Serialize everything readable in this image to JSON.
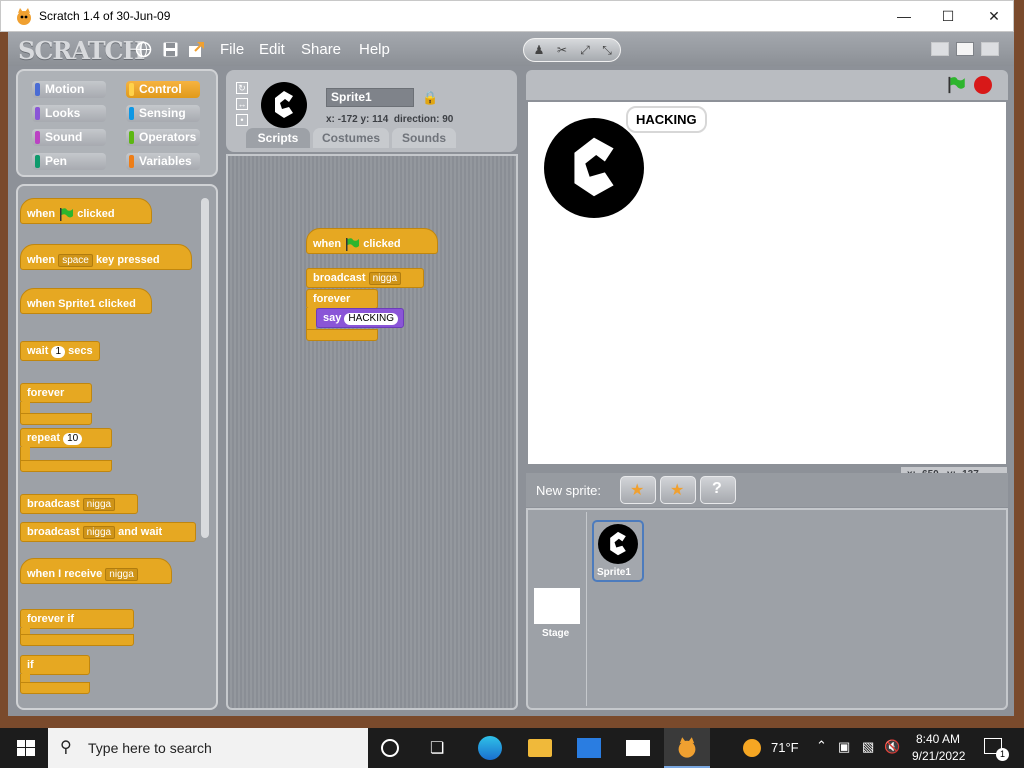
{
  "window": {
    "title": "Scratch 1.4 of 30-Jun-09"
  },
  "menubar": {
    "logo": "SCRATCH",
    "menus": [
      "File",
      "Edit",
      "Share",
      "Help"
    ]
  },
  "categories": [
    {
      "label": "Motion",
      "color": "#4a6cd4"
    },
    {
      "label": "Control",
      "color": "#e6a822",
      "selected": true
    },
    {
      "label": "Looks",
      "color": "#8a55d7"
    },
    {
      "label": "Sensing",
      "color": "#0c97e5"
    },
    {
      "label": "Sound",
      "color": "#bb42c3"
    },
    {
      "label": "Operators",
      "color": "#5cb712"
    },
    {
      "label": "Pen",
      "color": "#0e9a6c"
    },
    {
      "label": "Variables",
      "color": "#ee7d16"
    }
  ],
  "palette": {
    "when": "when",
    "clicked": "clicked",
    "space": "space",
    "key_pressed": "key pressed",
    "when_sprite_clicked": "when Sprite1 clicked",
    "wait": "wait",
    "wait_val": "1",
    "secs": "secs",
    "forever": "forever",
    "repeat": "repeat",
    "repeat_val": "10",
    "broadcast": "broadcast",
    "msg": "nigga",
    "and_wait": "and wait",
    "when_i_receive": "when I receive",
    "forever_if": "forever if",
    "if": "if"
  },
  "sprite": {
    "name": "Sprite1",
    "x_label": "x:",
    "x": "-172",
    "y_label": "y:",
    "y": "114",
    "direction_label": "direction:",
    "direction": "90"
  },
  "tabs": [
    "Scripts",
    "Costumes",
    "Sounds"
  ],
  "script": {
    "when": "when",
    "clicked": "clicked",
    "broadcast": "broadcast",
    "msg": "nigga",
    "forever": "forever",
    "say": "say",
    "say_val": "HACKING"
  },
  "stage": {
    "bubble": "HACKING",
    "mouse_x_label": "x:",
    "mouse_x": "-650",
    "mouse_y_label": "y:",
    "mouse_y": "-137"
  },
  "new_sprite": {
    "label": "New sprite:"
  },
  "sprites": {
    "sprite1": "Sprite1",
    "stage": "Stage"
  },
  "taskbar": {
    "search_placeholder": "Type here to search",
    "weather": "71°F",
    "time": "8:40 AM",
    "date": "9/21/2022",
    "notification_count": "1"
  }
}
